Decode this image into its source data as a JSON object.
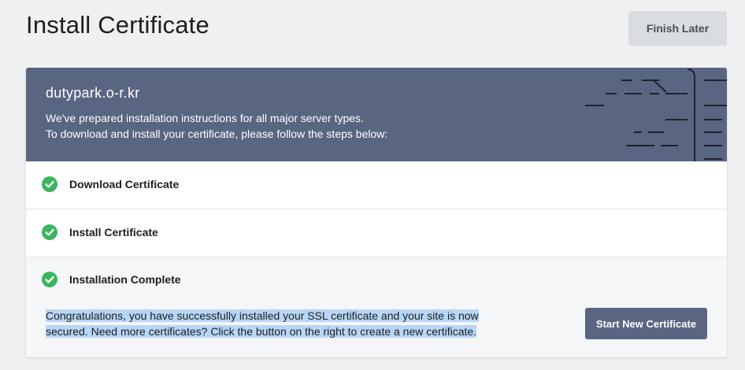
{
  "page": {
    "title": "Install Certificate",
    "finish_later_label": "Finish Later"
  },
  "card": {
    "domain": "dutypark.o-r.kr",
    "intro_line_1": "We've prepared installation instructions for all major server types.",
    "intro_line_2": "To download and install your certificate, please follow the steps below:",
    "steps": [
      {
        "label": "Download Certificate",
        "status": "complete"
      },
      {
        "label": "Install Certificate",
        "status": "complete"
      },
      {
        "label": "Installation Complete",
        "status": "complete"
      }
    ],
    "congrats_text": "Congratulations, you have successfully installed your SSL certificate and your site is now secured. Need more certificates? Click the button on the right to create a new certificate.",
    "start_new_label": "Start New Certificate"
  },
  "colors": {
    "header_bg": "#5a6582",
    "check_green": "#3bb560",
    "selection_highlight": "#b8d6f5",
    "secondary_button_bg": "#d9dde2"
  },
  "icons": [
    "check-circle-icon",
    "code-pattern-decoration"
  ]
}
